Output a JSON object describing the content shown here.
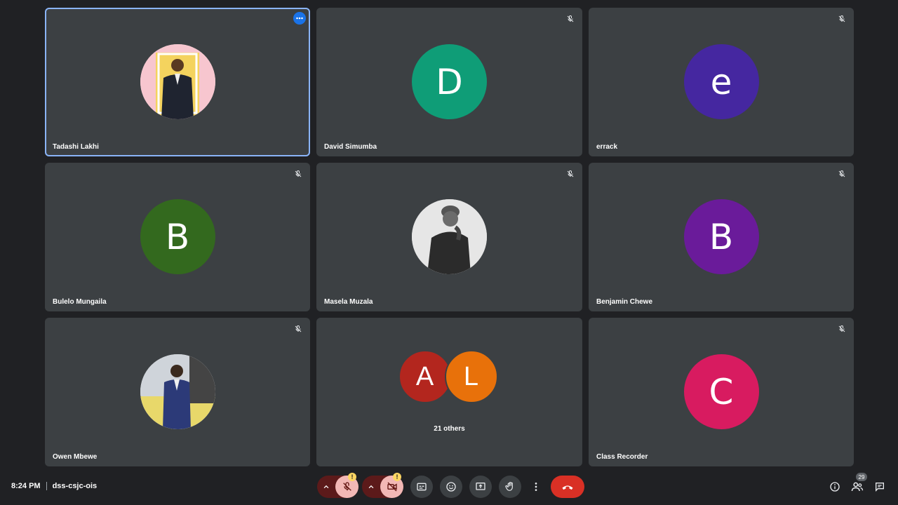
{
  "participants": [
    {
      "name": "Tadashi Lakhi",
      "type": "photo",
      "muted": false,
      "active": true
    },
    {
      "name": "David Simumba",
      "type": "letter",
      "letter": "D",
      "color": "#0f9d77",
      "muted": true
    },
    {
      "name": "errack",
      "type": "letter",
      "letter": "e",
      "color": "#4527a0",
      "muted": true
    },
    {
      "name": "Bulelo Mungaila",
      "type": "letter",
      "letter": "B",
      "color": "#33691e",
      "muted": true
    },
    {
      "name": "Masela Muzala",
      "type": "photo",
      "muted": true
    },
    {
      "name": "Benjamin Chewe",
      "type": "letter",
      "letter": "B",
      "color": "#6a1b9a",
      "muted": true
    },
    {
      "name": "Owen Mbewe",
      "type": "photo",
      "muted": true
    },
    {
      "name": "",
      "type": "group"
    },
    {
      "name": "Class Recorder",
      "type": "letter",
      "letter": "C",
      "color": "#d81b60",
      "muted": true
    }
  ],
  "group_tile": {
    "avatars": [
      {
        "letter": "A",
        "color": "#b3261e"
      },
      {
        "letter": "L",
        "color": "#e8710a"
      }
    ],
    "others_label": "21 others"
  },
  "status_bar": {
    "time": "8:24 PM",
    "meeting_code": "dss-csjc-ois"
  },
  "controls": {
    "mic_warning": "!",
    "camera_warning": "!",
    "icons": [
      "mic-off-icon",
      "camera-off-icon",
      "captions-icon",
      "emoji-icon",
      "present-icon",
      "raise-hand-icon",
      "more-options-icon",
      "end-call-icon"
    ]
  },
  "right_panel": {
    "participant_count": "29",
    "icons": [
      "info-icon",
      "people-icon",
      "chat-icon"
    ]
  },
  "colors": {
    "background": "#202124",
    "tile": "#3c4043",
    "active_border": "#8ab4f8",
    "end_call": "#d93025"
  }
}
